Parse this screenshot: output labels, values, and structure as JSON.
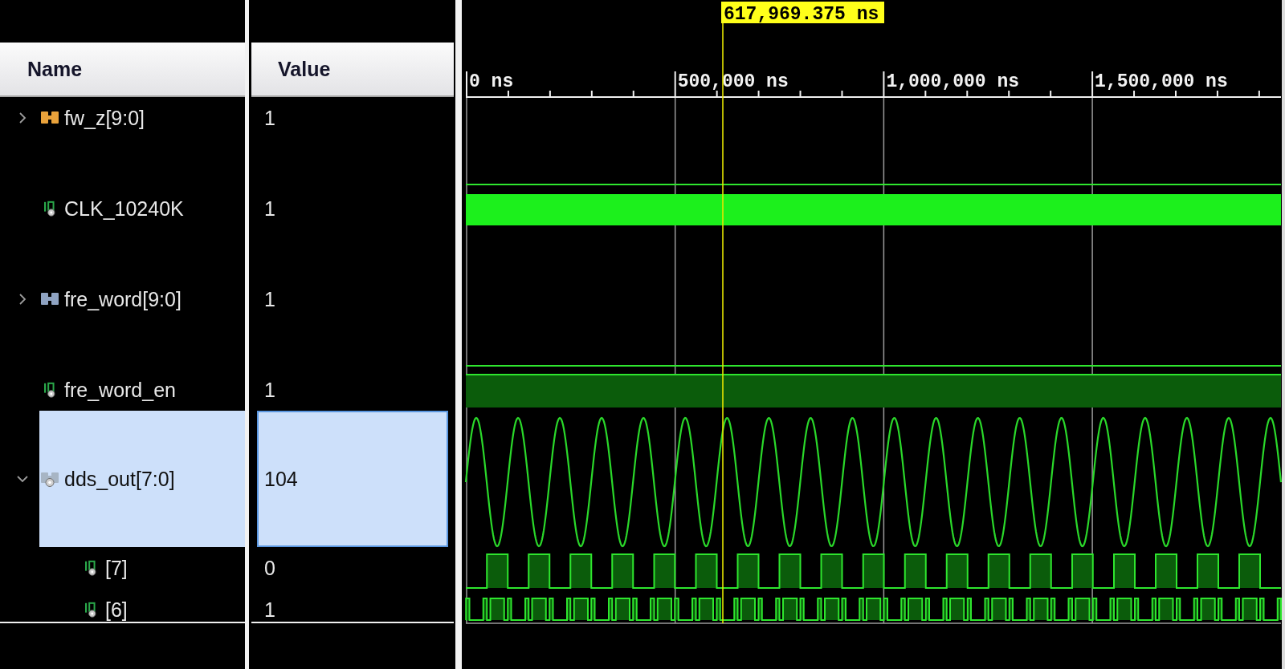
{
  "columns": [
    {
      "label": "Name"
    },
    {
      "label": "Value"
    }
  ],
  "signals": [
    {
      "name": "fw_z[9:0]",
      "value": "1",
      "kind": "bus",
      "color": "#e9a23b",
      "expanded": false,
      "selected": false
    },
    {
      "name": "CLK_10240K",
      "value": "1",
      "kind": "clock",
      "selected": false
    },
    {
      "name": "fre_word[9:0]",
      "value": "1",
      "kind": "bus",
      "color": "#8fa3c2",
      "expanded": false,
      "selected": false
    },
    {
      "name": "fre_word_en",
      "value": "1",
      "kind": "bit",
      "selected": false
    },
    {
      "name": "dds_out[7:0]",
      "value": "104",
      "kind": "analog",
      "expanded": true,
      "selected": true,
      "children": [
        {
          "name": "[7]",
          "value": "0",
          "kind": "bit",
          "selected": false
        },
        {
          "name": "[6]",
          "value": "1",
          "kind": "bit",
          "selected": false
        }
      ]
    }
  ],
  "ruler": {
    "ticks": [
      "0 ns",
      "500,000 ns",
      "1,000,000 ns",
      "1,500,000 ns"
    ]
  },
  "cursor": {
    "label": "617,969.375 ns"
  }
}
